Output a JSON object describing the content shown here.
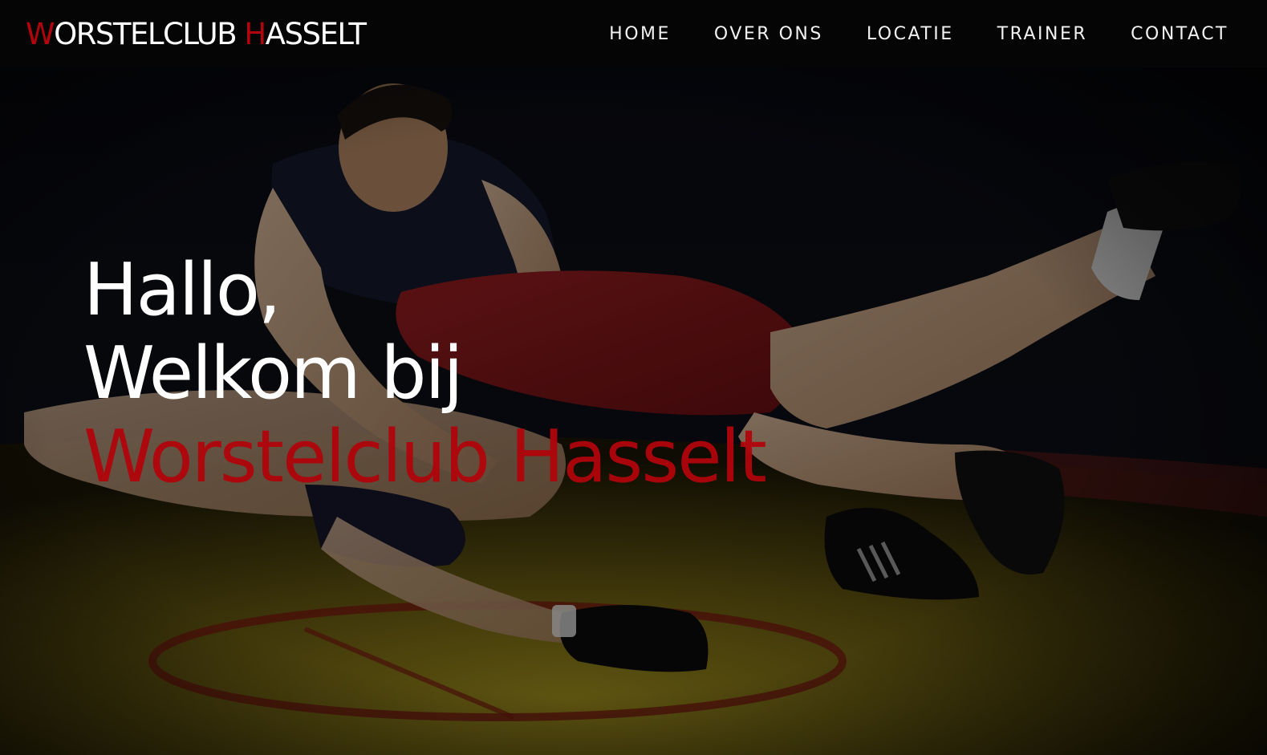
{
  "navbar": {
    "brand": {
      "first_initial": "W",
      "first_rest": "ORSTELCLUB ",
      "second_initial": "H",
      "second_rest": "ASSELT"
    },
    "items": [
      {
        "label": "HOME"
      },
      {
        "label": "OVER ONS"
      },
      {
        "label": "LOCATIE"
      },
      {
        "label": "TRAINER"
      },
      {
        "label": "CONTACT"
      }
    ]
  },
  "hero": {
    "greeting": "Hallo,",
    "welcome": "Welkom bij",
    "club_name": "Worstelclub Hasselt",
    "background_image": "wrestling-action-photo"
  },
  "colors": {
    "accent": "#b0050c",
    "navbar_bg": "#050505",
    "text": "#ffffff"
  }
}
